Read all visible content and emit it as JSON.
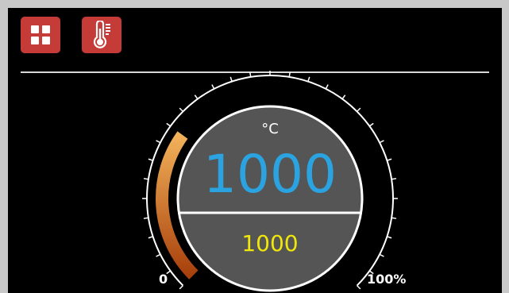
{
  "toolbar": {
    "apps_icon": "grid-icon",
    "temp_icon": "thermometer-icon",
    "tile_color": "#c43b38"
  },
  "gauge": {
    "unit": "°C",
    "actual_value": "1000",
    "setpoint_value": "1000",
    "scale_min_label": "0",
    "scale_max_label": "100%",
    "output_level_percent": 30,
    "colors": {
      "actual": "#2aa3e0",
      "setpoint": "#f0e60a",
      "arc_start": "#f2b25a",
      "arc_end": "#a8400c",
      "face": "#555555"
    }
  }
}
